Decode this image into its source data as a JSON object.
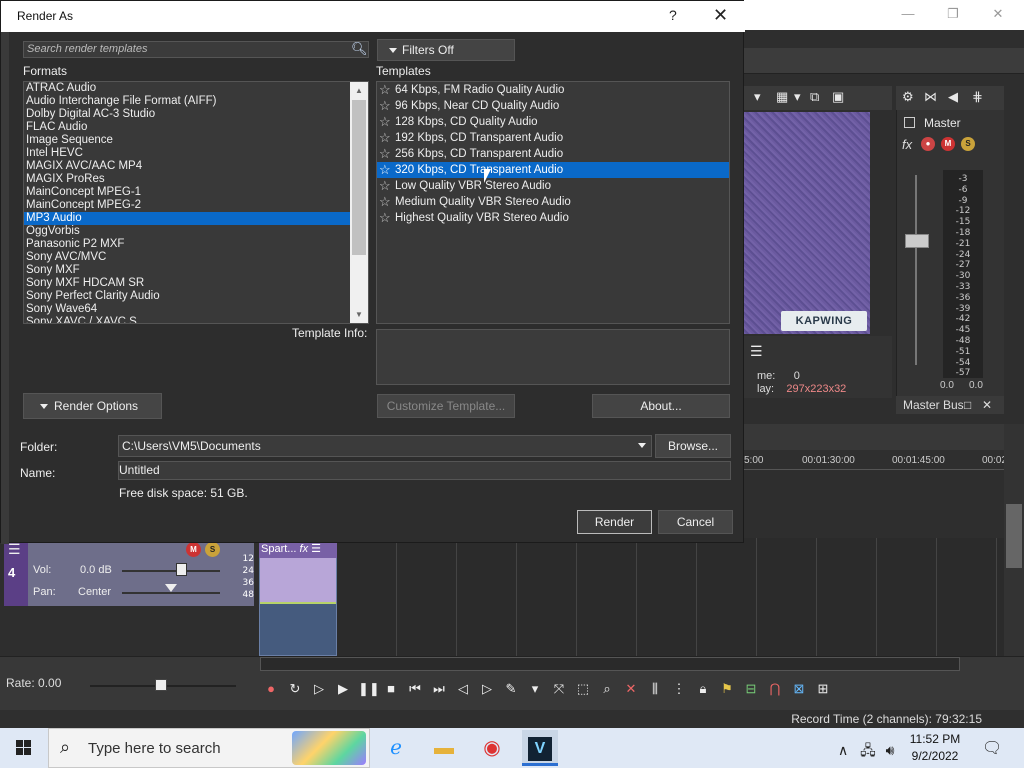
{
  "background_app": {
    "preview_info": {
      "frame_label": "me:",
      "frame_value": "0",
      "display_label": "lay:",
      "display_value": "297x223x32"
    },
    "watermark": "KAPWING",
    "mixer": {
      "master_label": "Master",
      "fx_label": "fx",
      "meter_ticks": [
        "-3",
        "-6",
        "-9",
        "-12",
        "-15",
        "-18",
        "-21",
        "-24",
        "-27",
        "-30",
        "-33",
        "-36",
        "-39",
        "-42",
        "-45",
        "-48",
        "-51",
        "-54",
        "-57"
      ],
      "meter_left": "0.0",
      "meter_right": "0.0",
      "bus_label": "Master Bus"
    },
    "ruler": [
      "5:00",
      "00:01:30:00",
      "00:01:45:00",
      "00:02"
    ],
    "track": {
      "number": "4",
      "vol_label": "Vol:",
      "vol_value": "0.0 dB",
      "pan_label": "Pan:",
      "pan_value": "Center",
      "levels": [
        "12",
        "24",
        "36",
        "48"
      ],
      "clip_title": "Spart...",
      "clip_fx": "fx"
    },
    "transport": {
      "rate": "Rate: 0.00"
    },
    "status": {
      "record_time": "Record Time (2 channels): 79:32:15"
    }
  },
  "taskbar": {
    "search_placeholder": "Type here to search",
    "time": "11:52 PM",
    "date": "9/2/2022"
  },
  "dialog": {
    "title": "Render As",
    "help": "?",
    "search_placeholder": "Search render templates",
    "filters_label": "Filters Off",
    "formats_label": "Formats",
    "templates_label": "Templates",
    "formats": [
      "ATRAC Audio",
      "Audio Interchange File Format (AIFF)",
      "Dolby Digital AC-3 Studio",
      "FLAC Audio",
      "Image Sequence",
      "Intel HEVC",
      "MAGIX AVC/AAC MP4",
      "MAGIX ProRes",
      "MainConcept MPEG-1",
      "MainConcept MPEG-2",
      "MP3 Audio",
      "OggVorbis",
      "Panasonic P2 MXF",
      "Sony AVC/MVC",
      "Sony MXF",
      "Sony MXF HDCAM SR",
      "Sony Perfect Clarity Audio",
      "Sony Wave64",
      "Sony XAVC / XAVC S"
    ],
    "selected_format": "MP3 Audio",
    "templates": [
      "64 Kbps, FM Radio Quality Audio",
      "96 Kbps, Near CD Quality Audio",
      "128 Kbps, CD Quality Audio",
      "192 Kbps, CD Transparent Audio",
      "256 Kbps, CD Transparent Audio",
      "320 Kbps, CD Transparent Audio",
      "Low Quality VBR Stereo Audio",
      "Medium Quality VBR Stereo Audio",
      "Highest Quality VBR Stereo Audio"
    ],
    "selected_template": "320 Kbps, CD Transparent Audio",
    "template_info_label": "Template Info:",
    "customize_label": "Customize Template...",
    "about_label": "About...",
    "render_options_label": "Render Options",
    "folder_label": "Folder:",
    "folder_value": "C:\\Users\\VM5\\Documents",
    "browse_label": "Browse...",
    "name_label": "Name:",
    "name_value": "Untitled",
    "disk_space": "Free disk space: 51 GB.",
    "render_label": "Render",
    "cancel_label": "Cancel"
  },
  "colors": {
    "selection": "#0a69c9",
    "dialog_bg": "#2d2d2d",
    "taskbar": "#dfe8f5"
  }
}
